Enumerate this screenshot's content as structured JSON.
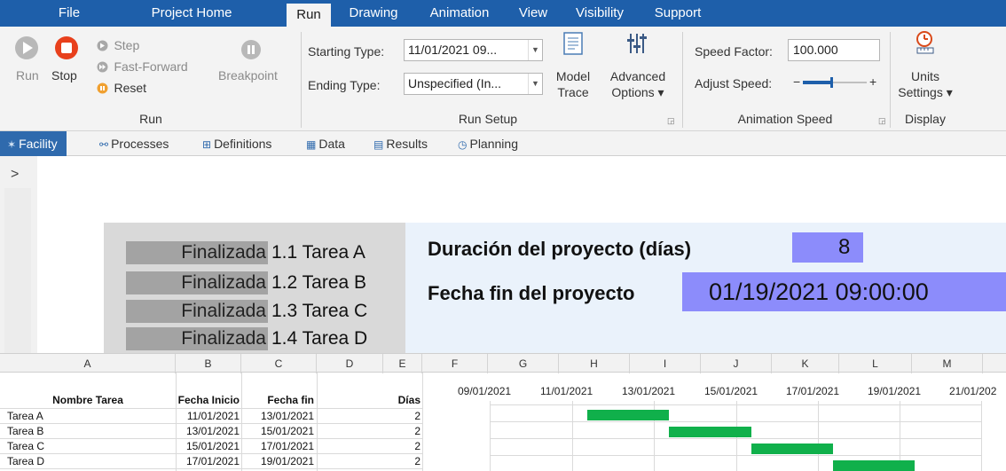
{
  "menubar": {
    "items": [
      "File",
      "Project Home",
      "Run",
      "Drawing",
      "Animation",
      "View",
      "Visibility",
      "Support"
    ],
    "active": "Run"
  },
  "ribbon": {
    "run_group": {
      "run_label": "Run",
      "stop_label": "Stop",
      "step_label": "Step",
      "fast_forward_label": "Fast-Forward",
      "reset_label": "Reset",
      "breakpoint_label": "Breakpoint",
      "group_label": "Run"
    },
    "run_setup": {
      "starting_type_label": "Starting Type:",
      "starting_type_value": "11/01/2021 09...",
      "ending_type_label": "Ending Type:",
      "ending_type_value": "Unspecified (In...",
      "model_trace_line1": "Model",
      "model_trace_line2": "Trace",
      "advanced_line1": "Advanced",
      "advanced_line2": "Options ▾",
      "group_label": "Run Setup"
    },
    "animation_speed": {
      "speed_factor_label": "Speed Factor:",
      "speed_factor_value": "100.000",
      "adjust_speed_label": "Adjust Speed:",
      "minus": "−",
      "plus": "+",
      "speed_level": 0.45,
      "group_label": "Animation Speed"
    },
    "display": {
      "units_line1": "Units",
      "units_line2": "Settings ▾",
      "group_label": "Display"
    }
  },
  "tabs": [
    {
      "icon": "facility-icon",
      "label": "Facility",
      "active": true
    },
    {
      "icon": "processes-icon",
      "label": "Processes"
    },
    {
      "icon": "definitions-icon",
      "label": "Definitions"
    },
    {
      "icon": "data-icon",
      "label": "Data"
    },
    {
      "icon": "results-icon",
      "label": "Results"
    },
    {
      "icon": "planning-icon",
      "label": "Planning"
    }
  ],
  "canvas": {
    "expand_glyph": ">",
    "tasks": [
      {
        "state": "Finalizada",
        "name": "1.1 Tarea A"
      },
      {
        "state": "Finalizada",
        "name": "1.2 Tarea B"
      },
      {
        "state": "Finalizada",
        "name": "1.3 Tarea C"
      },
      {
        "state": "Finalizada",
        "name": "1.4 Tarea D"
      }
    ],
    "duration_label": "Duración del proyecto (días)",
    "duration_value": "8",
    "end_date_label": "Fecha fin del proyecto",
    "end_date_value": "01/19/2021 09:00:00"
  },
  "sheet": {
    "columns": [
      "A",
      "B",
      "C",
      "D",
      "E",
      "F",
      "G",
      "H",
      "I",
      "J",
      "K",
      "L",
      "M"
    ],
    "headers": {
      "name": "Nombre Tarea",
      "start": "Fecha Inicio",
      "end": "Fecha fin",
      "days": "Días"
    },
    "rows": [
      {
        "name": "Tarea A",
        "start": "11/01/2021",
        "end": "13/01/2021",
        "days": "2"
      },
      {
        "name": "Tarea B",
        "start": "13/01/2021",
        "end": "15/01/2021",
        "days": "2"
      },
      {
        "name": "Tarea C",
        "start": "15/01/2021",
        "end": "17/01/2021",
        "days": "2"
      },
      {
        "name": "Tarea D",
        "start": "17/01/2021",
        "end": "19/01/2021",
        "days": "2"
      }
    ],
    "gantt_dates": [
      "09/01/2021",
      "11/01/2021",
      "13/01/2021",
      "15/01/2021",
      "17/01/2021",
      "19/01/2021",
      "21/01/202"
    ],
    "bar_color": "#10b04b"
  },
  "colors": {
    "menubar": "#1e5faa",
    "ribbon": "#f3f3f3",
    "active_tab": "#2f6aad",
    "highlight": "#8c8cfb",
    "stop_red": "#e8401c",
    "reset_orange": "#f0a030"
  }
}
